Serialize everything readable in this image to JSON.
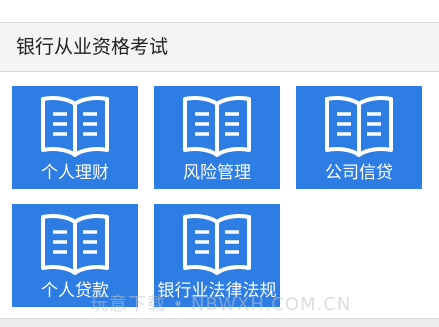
{
  "header": {
    "title": "银行从业资格考试"
  },
  "tiles": [
    {
      "label": "个人理财",
      "icon": "book-icon"
    },
    {
      "label": "风险管理",
      "icon": "book-icon"
    },
    {
      "label": "公司信贷",
      "icon": "book-icon"
    },
    {
      "label": "个人贷款",
      "icon": "book-icon"
    },
    {
      "label": "银行业法律法规",
      "icon": "book-icon"
    }
  ],
  "watermark": "玩意下载 • NBWXH.COM.CN",
  "colors": {
    "tile_bg": "#2d7de4",
    "header_bg": "#f4f4f6",
    "text": "#222222"
  }
}
